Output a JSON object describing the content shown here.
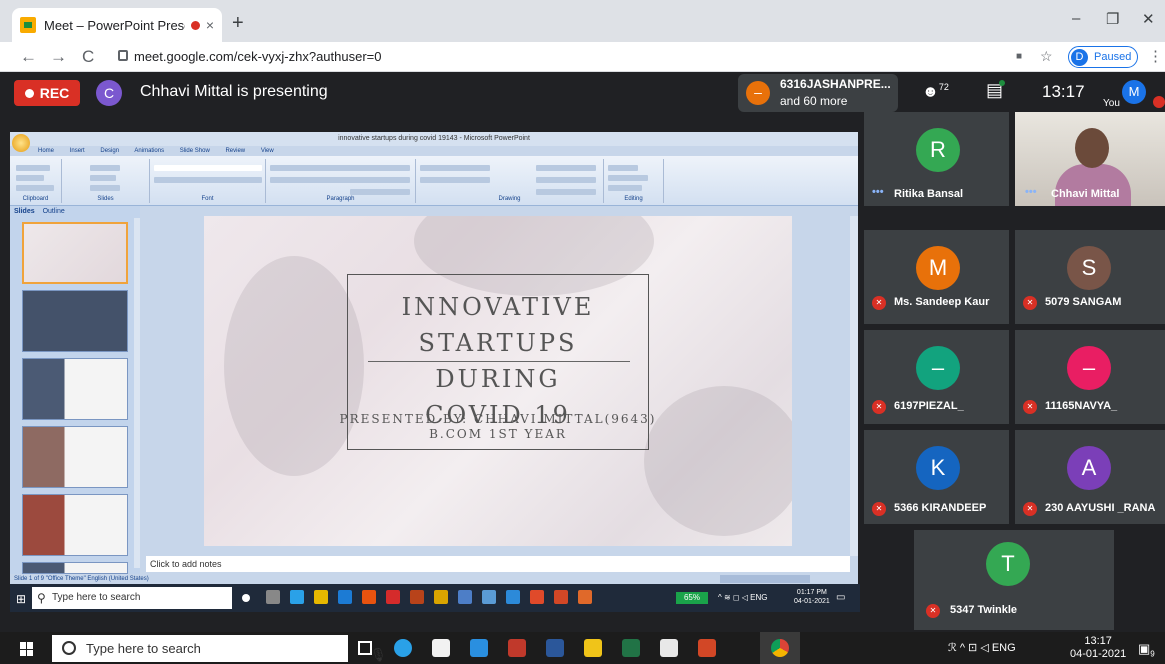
{
  "browser": {
    "tab_title": "Meet – PowerPoint Presentat",
    "tab_close": "×",
    "new_tab": "+",
    "url": "meet.google.com/cek-vyxj-zhx?authuser=0",
    "profile_initial": "D",
    "profile_status": "Paused",
    "back": "←",
    "forward": "→",
    "reload": "C",
    "minimize": "–",
    "restore": "❐",
    "close": "✕",
    "star": "☆",
    "menu": "⋮",
    "ext": "■"
  },
  "meet": {
    "rec_label": "REC",
    "presenter_initial": "C",
    "presenting_text": "Chhavi Mittal is presenting",
    "more_initial": "–",
    "more_name": "6316JASHANPRE...",
    "more_count": "and 60 more",
    "people_count": "72",
    "time": "13:17",
    "you_label": "You",
    "you_initial": "M"
  },
  "powerpoint": {
    "window_title": "innovative startups during covid 19143 - Microsoft PowerPoint",
    "ribbon_tabs": [
      "Home",
      "Insert",
      "Design",
      "Animations",
      "Slide Show",
      "Review",
      "View"
    ],
    "ribbon_groups": [
      "Clipboard",
      "Slides",
      "Font",
      "Paragraph",
      "Drawing",
      "Editing"
    ],
    "panel_tabs": [
      "Slides",
      "Outline"
    ],
    "slide_title_lines": [
      "INNOVATIVE",
      "STARTUPS",
      "DURING",
      "COVID 19"
    ],
    "presented_by": "PRESENTED BY: CHHAVI MITTAL(9643)",
    "course": "B.COM 1ST YEAR",
    "notes_placeholder": "Click to add notes",
    "status": "Slide 1 of 9  \"Office Theme\"  English (United States)"
  },
  "inner_taskbar": {
    "search_placeholder": "Type here to search",
    "battery": "65%",
    "tray": "^ ≋ ◻ ◁ ENG",
    "time": "01:17 PM",
    "date": "04-01-2021",
    "notif": "▭"
  },
  "participants": [
    {
      "name": "Ritika Bansal",
      "initial": "R",
      "color": "#34a853",
      "status": "dots"
    },
    {
      "name": "Chhavi Mittal",
      "initial": "",
      "color": "",
      "status": "dots",
      "video": true
    },
    {
      "name": "Ms. Sandeep Kaur",
      "initial": "M",
      "color": "#e8710a",
      "status": "muted"
    },
    {
      "name": "5079 SANGAM",
      "initial": "S",
      "color": "#795548",
      "status": "muted"
    },
    {
      "name": "6197PIEZAL_",
      "initial": "–",
      "color": "#12a37e",
      "status": "muted"
    },
    {
      "name": "11165NAVYA_",
      "initial": "–",
      "color": "#e91e63",
      "status": "muted"
    },
    {
      "name": "5366 KIRANDEEP",
      "initial": "K",
      "color": "#1565c0",
      "status": "muted"
    },
    {
      "name": "230 AAYUSHI _RANA",
      "initial": "A",
      "color": "#7b3fb8",
      "status": "muted"
    },
    {
      "name": "5347 Twinkle",
      "initial": "T",
      "color": "#34a853",
      "status": "muted"
    }
  ],
  "taskbar": {
    "search_placeholder": "Type here to search",
    "tray": "ℛ  ^ ⊡ ◁ ENG",
    "time": "13:17",
    "date": "04-01-2021",
    "notif_count": "9"
  }
}
